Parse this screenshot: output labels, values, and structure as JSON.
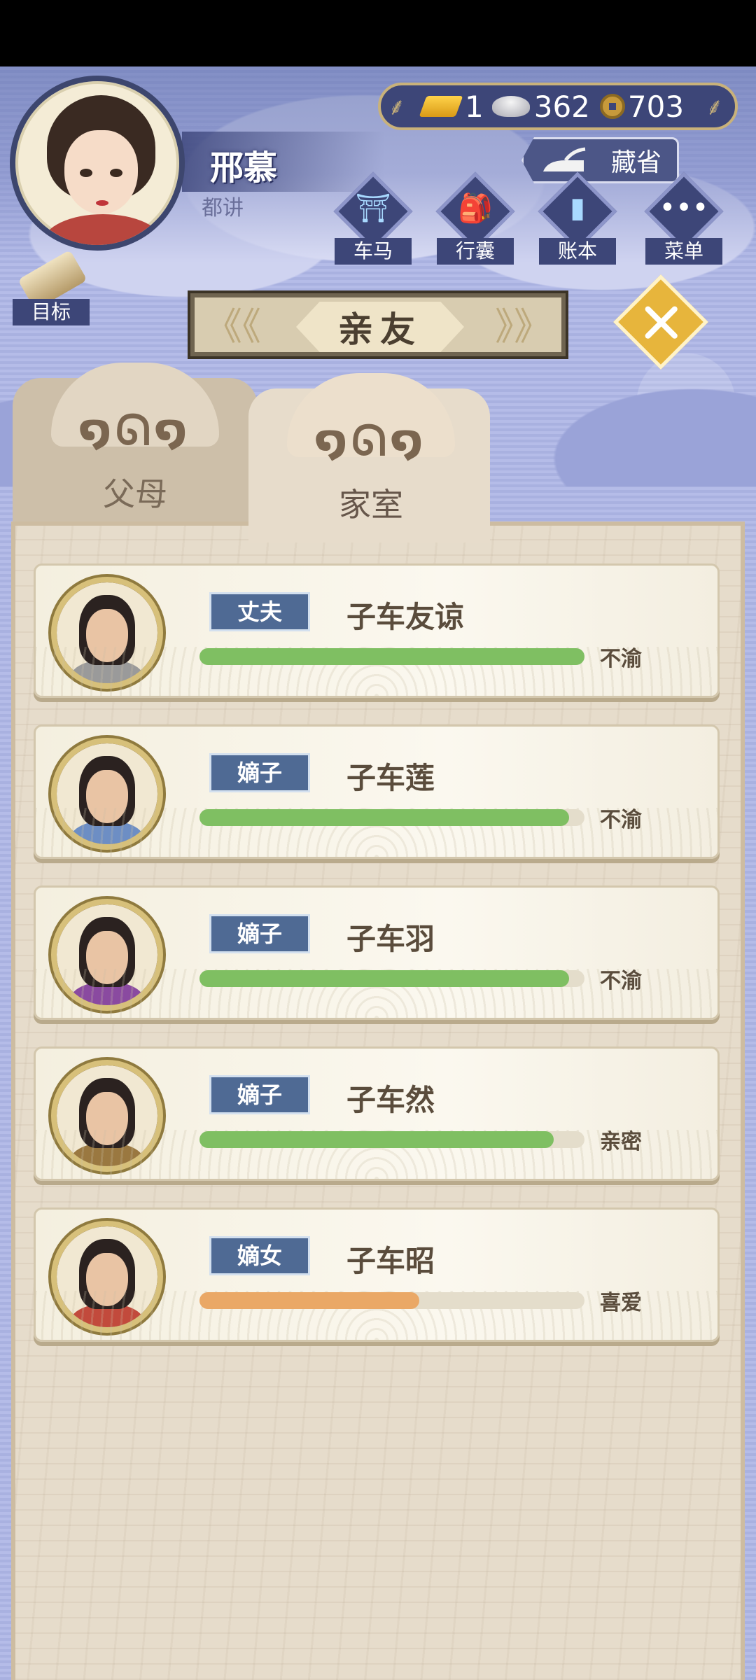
{
  "player": {
    "name": "邢慕",
    "title": "都讲"
  },
  "currency": {
    "gold": "1",
    "silver": "362",
    "coins": "703"
  },
  "collection": {
    "label": "藏省"
  },
  "menu": [
    {
      "label": "车马",
      "icon": "carriage-icon"
    },
    {
      "label": "行囊",
      "icon": "bundle-icon"
    },
    {
      "label": "账本",
      "icon": "ledger-icon"
    },
    {
      "label": "菜单",
      "icon": "more-icon"
    }
  ],
  "goal": {
    "label": "目标"
  },
  "page_title": "亲友",
  "tabs": [
    {
      "label": "父母",
      "active": false
    },
    {
      "label": "家室",
      "active": true
    }
  ],
  "relatives": [
    {
      "relation": "丈夫",
      "name": "子车友谅",
      "mood": "不渝",
      "affinity": 1.0,
      "bar_color": "#7fbf62",
      "robe": "#9a9a9a"
    },
    {
      "relation": "嫡子",
      "name": "子车莲",
      "mood": "不渝",
      "affinity": 0.96,
      "bar_color": "#7fbf62",
      "robe": "#6d8ec4"
    },
    {
      "relation": "嫡子",
      "name": "子车羽",
      "mood": "不渝",
      "affinity": 0.96,
      "bar_color": "#7fbf62",
      "robe": "#8a4aa0"
    },
    {
      "relation": "嫡子",
      "name": "子车然",
      "mood": "亲密",
      "affinity": 0.92,
      "bar_color": "#7fbf62",
      "robe": "#9a7840"
    },
    {
      "relation": "嫡女",
      "name": "子车昭",
      "mood": "喜爱",
      "affinity": 0.57,
      "bar_color": "#eaa866",
      "robe": "#c24a3c"
    }
  ]
}
